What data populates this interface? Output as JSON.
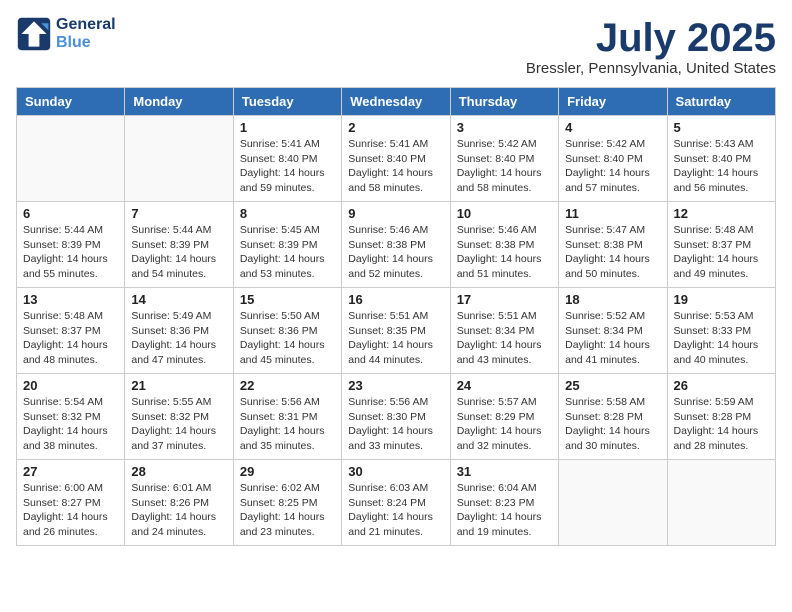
{
  "header": {
    "logo_line1": "General",
    "logo_line2": "Blue",
    "month": "July 2025",
    "location": "Bressler, Pennsylvania, United States"
  },
  "days_of_week": [
    "Sunday",
    "Monday",
    "Tuesday",
    "Wednesday",
    "Thursday",
    "Friday",
    "Saturday"
  ],
  "weeks": [
    [
      {
        "day": "",
        "info": ""
      },
      {
        "day": "",
        "info": ""
      },
      {
        "day": "1",
        "info": "Sunrise: 5:41 AM\nSunset: 8:40 PM\nDaylight: 14 hours and 59 minutes."
      },
      {
        "day": "2",
        "info": "Sunrise: 5:41 AM\nSunset: 8:40 PM\nDaylight: 14 hours and 58 minutes."
      },
      {
        "day": "3",
        "info": "Sunrise: 5:42 AM\nSunset: 8:40 PM\nDaylight: 14 hours and 58 minutes."
      },
      {
        "day": "4",
        "info": "Sunrise: 5:42 AM\nSunset: 8:40 PM\nDaylight: 14 hours and 57 minutes."
      },
      {
        "day": "5",
        "info": "Sunrise: 5:43 AM\nSunset: 8:40 PM\nDaylight: 14 hours and 56 minutes."
      }
    ],
    [
      {
        "day": "6",
        "info": "Sunrise: 5:44 AM\nSunset: 8:39 PM\nDaylight: 14 hours and 55 minutes."
      },
      {
        "day": "7",
        "info": "Sunrise: 5:44 AM\nSunset: 8:39 PM\nDaylight: 14 hours and 54 minutes."
      },
      {
        "day": "8",
        "info": "Sunrise: 5:45 AM\nSunset: 8:39 PM\nDaylight: 14 hours and 53 minutes."
      },
      {
        "day": "9",
        "info": "Sunrise: 5:46 AM\nSunset: 8:38 PM\nDaylight: 14 hours and 52 minutes."
      },
      {
        "day": "10",
        "info": "Sunrise: 5:46 AM\nSunset: 8:38 PM\nDaylight: 14 hours and 51 minutes."
      },
      {
        "day": "11",
        "info": "Sunrise: 5:47 AM\nSunset: 8:38 PM\nDaylight: 14 hours and 50 minutes."
      },
      {
        "day": "12",
        "info": "Sunrise: 5:48 AM\nSunset: 8:37 PM\nDaylight: 14 hours and 49 minutes."
      }
    ],
    [
      {
        "day": "13",
        "info": "Sunrise: 5:48 AM\nSunset: 8:37 PM\nDaylight: 14 hours and 48 minutes."
      },
      {
        "day": "14",
        "info": "Sunrise: 5:49 AM\nSunset: 8:36 PM\nDaylight: 14 hours and 47 minutes."
      },
      {
        "day": "15",
        "info": "Sunrise: 5:50 AM\nSunset: 8:36 PM\nDaylight: 14 hours and 45 minutes."
      },
      {
        "day": "16",
        "info": "Sunrise: 5:51 AM\nSunset: 8:35 PM\nDaylight: 14 hours and 44 minutes."
      },
      {
        "day": "17",
        "info": "Sunrise: 5:51 AM\nSunset: 8:34 PM\nDaylight: 14 hours and 43 minutes."
      },
      {
        "day": "18",
        "info": "Sunrise: 5:52 AM\nSunset: 8:34 PM\nDaylight: 14 hours and 41 minutes."
      },
      {
        "day": "19",
        "info": "Sunrise: 5:53 AM\nSunset: 8:33 PM\nDaylight: 14 hours and 40 minutes."
      }
    ],
    [
      {
        "day": "20",
        "info": "Sunrise: 5:54 AM\nSunset: 8:32 PM\nDaylight: 14 hours and 38 minutes."
      },
      {
        "day": "21",
        "info": "Sunrise: 5:55 AM\nSunset: 8:32 PM\nDaylight: 14 hours and 37 minutes."
      },
      {
        "day": "22",
        "info": "Sunrise: 5:56 AM\nSunset: 8:31 PM\nDaylight: 14 hours and 35 minutes."
      },
      {
        "day": "23",
        "info": "Sunrise: 5:56 AM\nSunset: 8:30 PM\nDaylight: 14 hours and 33 minutes."
      },
      {
        "day": "24",
        "info": "Sunrise: 5:57 AM\nSunset: 8:29 PM\nDaylight: 14 hours and 32 minutes."
      },
      {
        "day": "25",
        "info": "Sunrise: 5:58 AM\nSunset: 8:28 PM\nDaylight: 14 hours and 30 minutes."
      },
      {
        "day": "26",
        "info": "Sunrise: 5:59 AM\nSunset: 8:28 PM\nDaylight: 14 hours and 28 minutes."
      }
    ],
    [
      {
        "day": "27",
        "info": "Sunrise: 6:00 AM\nSunset: 8:27 PM\nDaylight: 14 hours and 26 minutes."
      },
      {
        "day": "28",
        "info": "Sunrise: 6:01 AM\nSunset: 8:26 PM\nDaylight: 14 hours and 24 minutes."
      },
      {
        "day": "29",
        "info": "Sunrise: 6:02 AM\nSunset: 8:25 PM\nDaylight: 14 hours and 23 minutes."
      },
      {
        "day": "30",
        "info": "Sunrise: 6:03 AM\nSunset: 8:24 PM\nDaylight: 14 hours and 21 minutes."
      },
      {
        "day": "31",
        "info": "Sunrise: 6:04 AM\nSunset: 8:23 PM\nDaylight: 14 hours and 19 minutes."
      },
      {
        "day": "",
        "info": ""
      },
      {
        "day": "",
        "info": ""
      }
    ]
  ]
}
